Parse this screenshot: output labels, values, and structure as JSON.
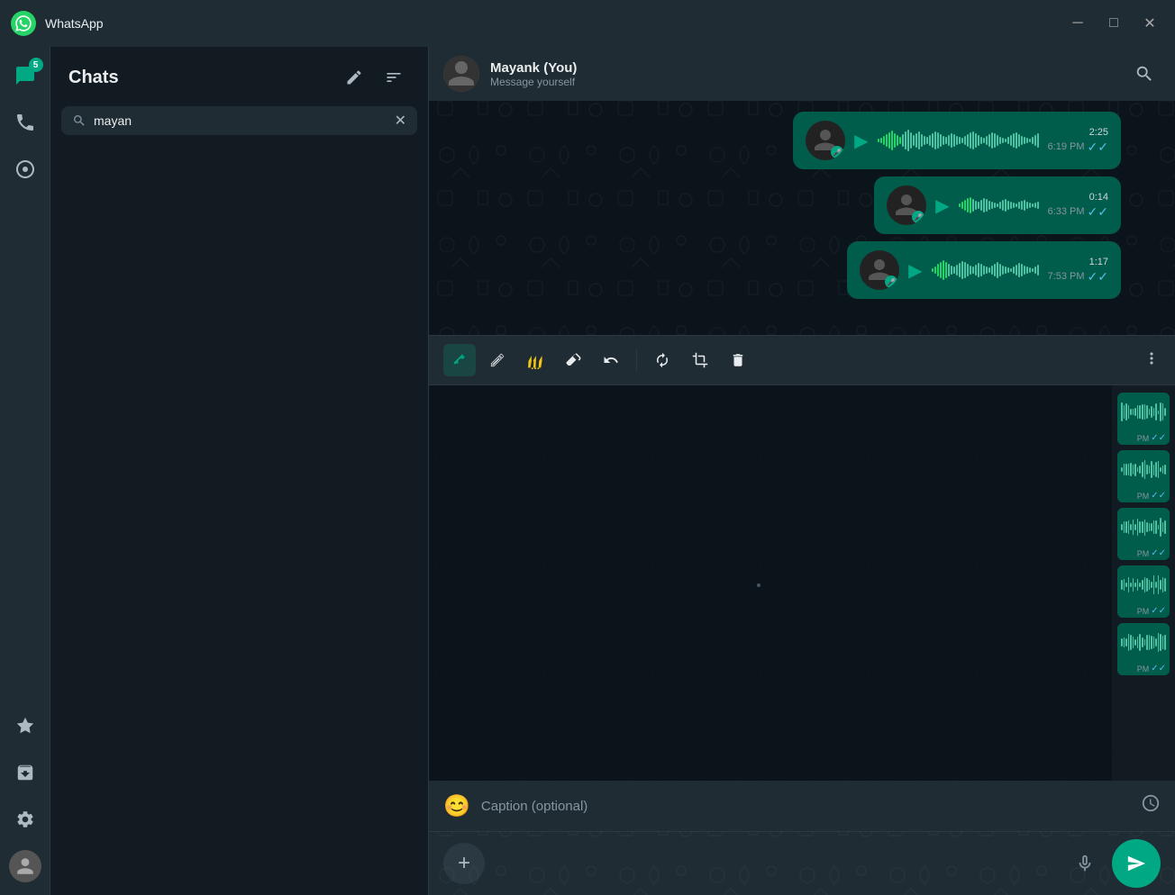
{
  "titlebar": {
    "title": "WhatsApp",
    "min_label": "─",
    "max_label": "□",
    "close_label": "✕"
  },
  "sidebar": {
    "chat_badge": "5",
    "icons": [
      {
        "name": "chats",
        "symbol": "💬",
        "badge": "5",
        "active": true
      },
      {
        "name": "calls",
        "symbol": "📞",
        "badge": null
      },
      {
        "name": "status",
        "symbol": "⊙",
        "badge": null
      }
    ]
  },
  "chats_panel": {
    "title": "Chats",
    "compose_label": "✏",
    "filter_label": "≡",
    "search_placeholder": "mayan",
    "search_value": "mayan"
  },
  "chat_header": {
    "name": "Mayank (You)",
    "subtitle": "Message yourself",
    "search_tooltip": "Search"
  },
  "voice_messages": [
    {
      "duration": "2:25",
      "time": "6:19 PM",
      "read": true
    },
    {
      "duration": "0:14",
      "time": "6:33 PM",
      "read": true
    },
    {
      "duration": "1:17",
      "time": "7:53 PM",
      "read": true
    }
  ],
  "toolbar": {
    "tools": [
      {
        "name": "pen-tool",
        "symbol": "▽",
        "active": true
      },
      {
        "name": "pen-outline-tool",
        "symbol": "▽"
      },
      {
        "name": "highlight-tool",
        "symbol": "▼"
      },
      {
        "name": "eraser-tool",
        "symbol": "◻"
      },
      {
        "name": "undo-tool",
        "symbol": "↩"
      },
      {
        "name": "crop-rotate-tool",
        "symbol": "⟳"
      },
      {
        "name": "crop-tool",
        "symbol": "⬜"
      },
      {
        "name": "delete-tool",
        "symbol": "🗑"
      }
    ],
    "more_label": "•••"
  },
  "caption": {
    "placeholder": "Caption (optional)"
  },
  "thumbnails": [
    {
      "time": "PM",
      "read": true
    },
    {
      "time": "PM",
      "read": true
    },
    {
      "time": "PM",
      "read": true
    },
    {
      "time": "PM",
      "read": true
    },
    {
      "time": "PM",
      "read": true
    }
  ],
  "bottom_bar": {
    "add_label": "+",
    "send_label": "➤",
    "mic_label": "🎤"
  }
}
